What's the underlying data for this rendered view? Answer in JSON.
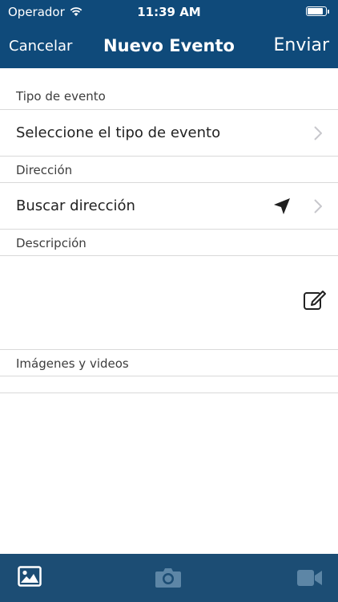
{
  "status_bar": {
    "carrier": "Operador",
    "time": "11:39 AM",
    "battery_level": 0.95
  },
  "nav": {
    "left_label": "Cancelar",
    "title": "Nuevo Evento",
    "right_label": "Enviar"
  },
  "form": {
    "event_type_label": "Tipo de evento",
    "event_type_value": "Seleccione el tipo de evento",
    "address_label": "Dirección",
    "address_value": "Buscar dirección",
    "description_label": "Descripción",
    "media_label": "Imágenes y videos"
  },
  "toolbar": {
    "icons": [
      "image-icon",
      "camera-icon",
      "video-icon"
    ]
  },
  "colors": {
    "header": "#0f4a7a",
    "toolbar": "#1c4d74",
    "separator": "#d9d9d9",
    "chevron": "#c7c7cc"
  }
}
